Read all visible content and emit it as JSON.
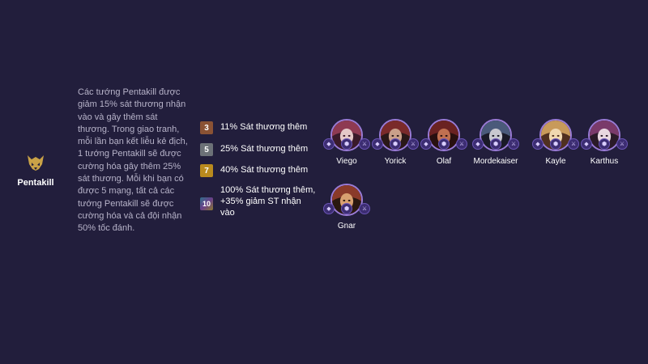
{
  "trait": {
    "name": "Pentakill",
    "icon": "pentakill-helmet-icon",
    "icon_color": "#c9a247",
    "description": "Các tướng Pentakill được giảm 15% sát thương nhận vào và gây thêm sát thương. Trong giao tranh, mỗi lần bạn kết liễu kẻ địch, 1 tướng Pentakill sẽ được cường hóa gây thêm 25% sát thương. Mỗi khi bạn có được 5 mạng, tất cả các tướng Pentakill sẽ được cường hóa và cả đội nhận 50% tốc đánh."
  },
  "breakpoints": [
    {
      "count": "3",
      "effect": "11% Sát thương thêm",
      "tier": "bronze",
      "color": "#8a5234"
    },
    {
      "count": "5",
      "effect": "25% Sát thương thêm",
      "tier": "silver",
      "color": "#6c7177"
    },
    {
      "count": "7",
      "effect": "40% Sát thương thêm",
      "tier": "gold",
      "color": "#b98a1e"
    },
    {
      "count": "10",
      "effect": "100% Sát thương thêm, +35% giảm ST nhận vào",
      "tier": "chromatic",
      "color": "#2f6f8a"
    }
  ],
  "champions": [
    {
      "name": "Viego",
      "items": [
        "rune-icon",
        "shield-icon",
        "sword-icon"
      ],
      "palette": [
        "#8e3a52",
        "#e4c8c8",
        "#3a1a2a"
      ]
    },
    {
      "name": "Yorick",
      "items": [
        "rune-icon",
        "shield-icon",
        "sword-icon"
      ],
      "palette": [
        "#7a2a2a",
        "#c9a08a",
        "#2a1818"
      ]
    },
    {
      "name": "Olaf",
      "items": [
        "rune-icon",
        "shield-icon",
        "sword-icon"
      ],
      "palette": [
        "#6a2222",
        "#c07050",
        "#281010"
      ]
    },
    {
      "name": "Mordekaiser",
      "items": [
        "rune-icon",
        "shield-icon",
        "sword-icon"
      ],
      "palette": [
        "#4a5a7a",
        "#c8c8d0",
        "#1a1a28"
      ]
    },
    {
      "name": "Kayle",
      "items": [
        "rune-icon",
        "shield-icon",
        "sword-icon"
      ],
      "palette": [
        "#c89a5a",
        "#f0d8b0",
        "#503020"
      ]
    },
    {
      "name": "Karthus",
      "items": [
        "rune-icon",
        "shield-icon",
        "sword-icon"
      ],
      "palette": [
        "#7a3a6a",
        "#e8d8e0",
        "#2a1a28"
      ]
    },
    {
      "name": "Gnar",
      "items": [
        "rune-icon",
        "shield-icon",
        "sword-icon"
      ],
      "palette": [
        "#8a3a2a",
        "#d8a070",
        "#2a1810"
      ]
    }
  ]
}
